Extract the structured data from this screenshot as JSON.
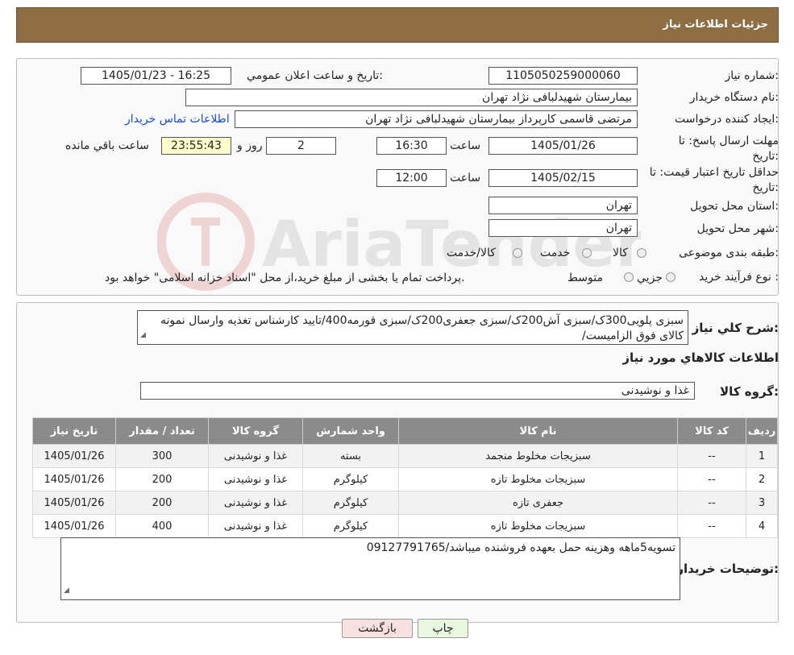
{
  "header": {
    "title": "جزئیات اطلاعات نیاز"
  },
  "need_number": {
    "label": "شماره نیاز:",
    "value": "1105050259000060"
  },
  "announce": {
    "label": "تاریخ و ساعت اعلان عمومي:",
    "value": "1405/01/23 - 16:25"
  },
  "buyer_org": {
    "label": "نام دستگاه خريدار:",
    "value": "بیمارستان شهیدلبافی نژاد تهران"
  },
  "creator": {
    "label": "ايجاد كننده درخواست:",
    "value": "مرتضی  قاسمی کارپرداز بیمارستان شهیدلبافی نژاد تهران",
    "contact_link": "اطلاعات تماس خريدار"
  },
  "reply_deadline": {
    "label": "مهلت ارسال پاسخ: تا تاریخ:",
    "date": "1405/01/26",
    "time_label": "ساعت",
    "time": "16:30",
    "days": "2",
    "days_label": "روز و",
    "remaining": "23:55:43",
    "remaining_label": "ساعت باقي مانده"
  },
  "price_validity": {
    "label": "حداقل تاريخ اعتبار قيمت: تا تاریخ:",
    "date": "1405/02/15",
    "time_label": "ساعت",
    "time": "12:00"
  },
  "province": {
    "label": "استان محل تحويل:",
    "value": "تهران"
  },
  "city": {
    "label": "شهر محل تحويل:",
    "value": "تهران"
  },
  "category": {
    "label": "طبقه بندی موضوعی:",
    "options": [
      "كالا",
      "خدمت",
      "كالا/خدمت"
    ]
  },
  "process_type": {
    "label": "نوع فرآيند خريد :",
    "options": [
      "جزيي",
      "متوسط"
    ],
    "note": "پرداخت تمام يا بخشی از مبلغ خريد،از محل \"اسناد خزانه اسلامی\" خواهد بود."
  },
  "description": {
    "label": "شرح كلي نياز:",
    "value": "سبزی پلویی300ک/سبزی آش200ک/سبزی جعفری200ک/سبزی قورمه400/تایید کارشناس تغذیه وارسال نمونه کالای فوق الزامیست/"
  },
  "goods_info_title": "اطلاعات كالاهاي مورد نياز",
  "goods_group": {
    "label": "گروه كالا:",
    "value": "غذا و نوشیدنی"
  },
  "table": {
    "headers": [
      "رديف",
      "كد كالا",
      "نام كالا",
      "واحد شمارش",
      "گروه كالا",
      "تعداد / مقدار",
      "تاريخ نياز"
    ],
    "rows": [
      [
        "1",
        "--",
        "سبزیجات مخلوط منجمد",
        "بسته",
        "غذا و نوشیدنی",
        "300",
        "1405/01/26"
      ],
      [
        "2",
        "--",
        "سبزیجات مخلوط تازه",
        "کیلوگرم",
        "غذا و نوشیدنی",
        "200",
        "1405/01/26"
      ],
      [
        "3",
        "--",
        "جعفری تازه",
        "کیلوگرم",
        "غذا و نوشیدنی",
        "200",
        "1405/01/26"
      ],
      [
        "4",
        "--",
        "سبزیجات مخلوط تازه",
        "کیلوگرم",
        "غذا و نوشیدنی",
        "400",
        "1405/01/26"
      ]
    ]
  },
  "buyer_notes": {
    "label": "توضيحات خريدار:",
    "value": "تسویه5ماهه وهزینه حمل بعهده فروشنده میباشد/09127791765"
  },
  "buttons": {
    "print": "چاپ",
    "back": "بازگشت"
  },
  "watermark": {
    "text": "AriaTender.neT"
  },
  "colors": {
    "header_bg": "#8d6e43",
    "table_header_bg": "#8b8b8b",
    "link": "#1a4bd6",
    "remaining_bg": "#ffffcc",
    "print_bg": "#eaf7e0",
    "back_bg": "#f7e0e0"
  }
}
